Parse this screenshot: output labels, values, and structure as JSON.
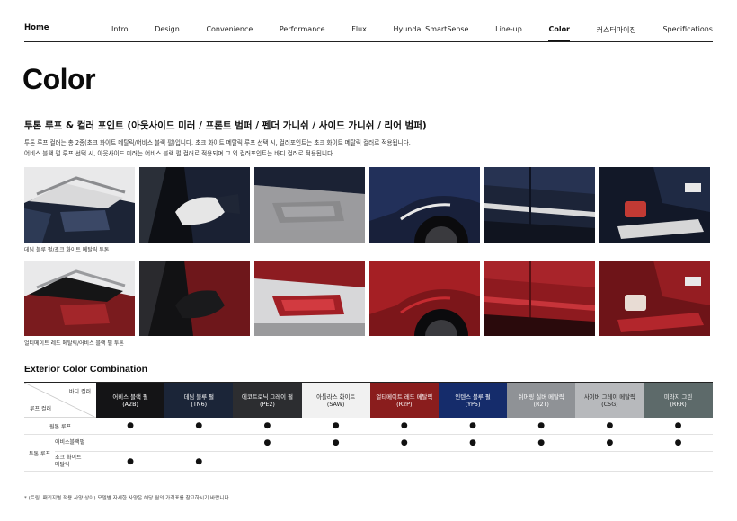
{
  "nav": {
    "home": "Home",
    "items": [
      "Intro",
      "Design",
      "Convenience",
      "Performance",
      "Flux",
      "Hyundai SmartSense",
      "Line-up",
      "Color",
      "커스터마이징",
      "Specifications"
    ],
    "active_index": 7
  },
  "page_title": "Color",
  "two_tone": {
    "heading": "투톤 루프 & 컬러 포인트 (아웃사이드 미러 / 프론트 범퍼 / 펜더 가니쉬 / 사이드 가니쉬 / 리어 범퍼)",
    "desc_line1": "투톤 루프 컬러는 총 2종(초크 화이트 메탈릭/어비스 블랙 펄)입니다. 초크 화이트 메탈릭 루프 선택 시, 컬러포인트는 초크 화이트 메탈릭 컬러로 적용됩니다.",
    "desc_line2": "어비스 블랙 펄 루프 선택 시, 아웃사이드 미러는 어비스 블랙 펄 컬러로 적용되며 그 외 컬러포인트는 바디 컬러로 적용됩니다.",
    "caption_row1": "데님 블루 펄/초크 화이트 메탈릭 투톤",
    "caption_row2": "얼티메이트 레드 메탈릭/어비스 블랙 펄 투톤"
  },
  "combination": {
    "heading": "Exterior Color Combination",
    "body_color_label": "바디 컬러",
    "roof_color_label": "루프 컬러",
    "colors": [
      {
        "name": "어비스 블랙 펄",
        "code": "(A2B)",
        "hex": "#141416",
        "text": "dark"
      },
      {
        "name": "데님 블루 펄",
        "code": "(TN6)",
        "hex": "#1b2538",
        "text": "dark"
      },
      {
        "name": "에코트로닉 그레이 펄",
        "code": "(PE2)",
        "hex": "#2c2d30",
        "text": "dark"
      },
      {
        "name": "아틀라스 화이트",
        "code": "(SAW)",
        "hex": "#f1f1f1",
        "text": "light"
      },
      {
        "name": "얼티메이트 레드 메탈릭",
        "code": "(R2P)",
        "hex": "#8a1d1d",
        "text": "dark"
      },
      {
        "name": "인텐스 블루 펄",
        "code": "(YP5)",
        "hex": "#152c6b",
        "text": "dark"
      },
      {
        "name": "쉬머링 실버 메탈릭",
        "code": "(R2T)",
        "hex": "#8f9296",
        "text": "dark"
      },
      {
        "name": "사이버 그레이 메탈릭",
        "code": "(C5G)",
        "hex": "#b7b9bc",
        "text": "light"
      },
      {
        "name": "미라지 그린",
        "code": "(RRR)",
        "hex": "#5d6a6a",
        "text": "dark"
      }
    ],
    "rows": {
      "solid_label": "원톤 루프",
      "solid": [
        "●",
        "●",
        "●",
        "●",
        "●",
        "●",
        "●",
        "●",
        "●"
      ],
      "two_tone_label": "투톤 루프",
      "black_label": "어비스블랙펄",
      "black": [
        "",
        "",
        "●",
        "●",
        "●",
        "●",
        "●",
        "●",
        "●"
      ],
      "white_label_1": "초크 화이트",
      "white_label_2": "메탈릭",
      "white": [
        "●",
        "●",
        "",
        "",
        "",
        "",
        "",
        "",
        ""
      ]
    }
  },
  "footnote": "* (트림, 패키지별 적용 사양 상이) 모델별 자세한 사양은 해당 월의 가격표를 참고하시기 바랍니다.",
  "photo_icons": [
    "roof-photo-icon",
    "mirror-photo-icon",
    "front-bumper-photo-icon",
    "fender-garnish-photo-icon",
    "side-garnish-photo-icon",
    "rear-bumper-photo-icon"
  ]
}
